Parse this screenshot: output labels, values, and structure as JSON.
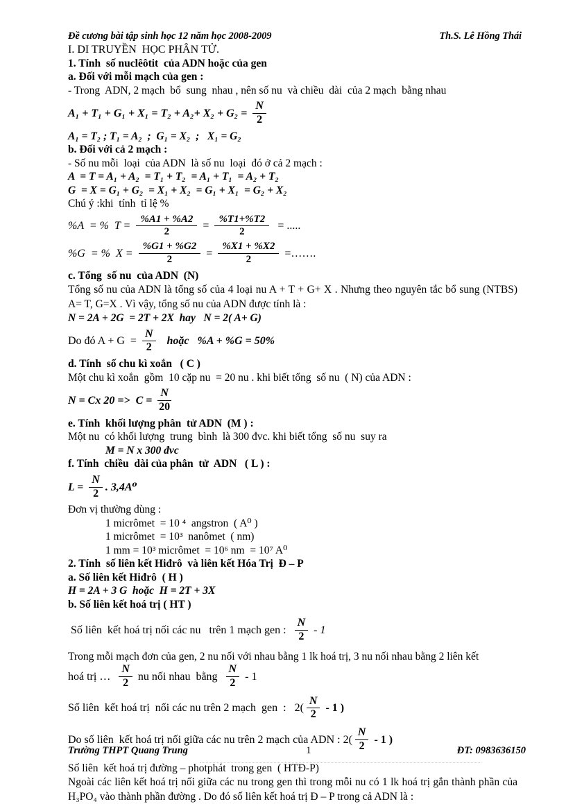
{
  "header": {
    "left": "Đề cương bài tập sinh học 12 năm học 2008-2009",
    "right": "Th.S. Lê Hồng Thái"
  },
  "sections": {
    "part1_title": "I. DI TRUYỀN  HỌC PHÂN TỬ.",
    "s1_title": "1. Tính  số nuclêôtit  của ADN hoặc của gen",
    "s1a_title": "a. Đối với mỗi mạch của gen :",
    "s1a_text": "- Trong  ADN, 2 mạch  bổ  sung  nhau , nên số nu  và chiều  dài  của 2 mạch  bằng nhau",
    "f1_left": "A₁ + T₁ + G₁ + X₁ = T₂ + A₂+ X₂ + G₂ = ",
    "f1_num": "N",
    "f1_den": "2",
    "f2": "A₁ = T₂ ; T₁ = A₂  ;  G₁ = X₂  ;   X₁ = G₂",
    "s1b_title": "b. Đối với cả 2 mạch :",
    "s1b_text": "- Số nu mỗi  loại  của ADN  là số nu  loại  đó ở cả 2 mạch :",
    "f3": "A  = T = A₁ + A₂  = T₁ + T₂  = A₁ + T₁  = A₂ + T₂",
    "f4": "G  = X = G₁ + G₂  = X₁ + X₂  = G₁ + X₁  = G₂ + X₂",
    "note_percent": "Chú ý :khi  tính  tỉ lệ %",
    "pa_label": "%A  = %  T = ",
    "pa_num1": "%A1 + %A2",
    "pa_den1": "2",
    "pa_eq": " = ",
    "pa_num2": "%T1+%T2",
    "pa_den2": "2",
    "pa_tail": "  = .....",
    "pg_label": "%G  = %  X = ",
    "pg_num1": "%G1 + %G2",
    "pg_den1": "2",
    "pg_eq": " = ",
    "pg_num2": "%X1 + %X2",
    "pg_den2": "2",
    "pg_tail": " =…….",
    "s1c_title": "c. Tổng  số nu  của ADN  (N)",
    "s1c_text": "Tổng  số nu  của ADN   là tổng  số của 4 loại  nu   A + T + G+ X . Nhưng  theo  nguyên  tắc bổ sung (NTBS) A= T, G=X . Vì vậy, tổng  số nu  của ADN  được tính  là :",
    "f5": "N = 2A + 2G  = 2T + 2X  hay   N = 2( A+ G)",
    "f6_pre": "Do đó A + G  = ",
    "f6_num": "N",
    "f6_den": "2",
    "f6_post": "   hoặc   %A + %G = 50%",
    "s1d_title": "d. Tính  số chu kì xoắn   ( C )",
    "s1d_text": "Một chu kì xoắn  gồm  10 cặp nu  = 20 nu . khi biết tổng  số nu  ( N) của ADN :",
    "f7_pre": "N = Cx 20 =>  C = ",
    "f7_num": "N",
    "f7_den": "20",
    "s1e_title": "e. Tính  khối lượng phân  tử ADN  (M ) :",
    "s1e_text": "Một nu  có khối lượng  trung  bình  là 300 đvc. khi biết tổng  số nu  suy ra",
    "f8": "M = N x 300 đvc",
    "s1f_title": "f. Tính  chiều  dài của phân  tử  ADN   ( L ) :",
    "f9_pre": "L = ",
    "f9_num": "N",
    "f9_den": "2",
    "f9_post": ". 3,4A⁰",
    "units_title": "Đơn vị thường dùng :",
    "unit1": "1 micrômet  = 10 ⁴  angstron  ( A⁰ )",
    "unit2": "1 micrômet  = 10³  nanômet  ( nm)",
    "unit3": "1 mm = 10³ micrômet  = 10⁶ nm  = 10⁷ A⁰",
    "s2_title": "2. Tính  số liên kết Hiđrô  và liên kết Hóa Trị  Đ – P",
    "s2a_title": "a. Số liên kết Hiđrô  ( H )",
    "f10": "H = 2A + 3 G  hoặc  H = 2T + 3X",
    "s2b_title": "b. Số liên kết hoá trị ( HT )",
    "f11_pre": " Số liên  kết hoá trị nối các nu   trên 1 mạch gen :  ",
    "f11_num": "N",
    "f11_den": "2",
    "f11_post": " - 1",
    "p_strand": "Trong mỗi  mạch  đơn  của gen, 2 nu  nối  với  nhau  bằng  1 lk hoá trị, 3 nu  nối nhau  bằng 2 liên  kết",
    "p_strand2_pre": "hoá trị …  ",
    "p_strand2_num": "N",
    "p_strand2_den": "2",
    "p_strand2_mid": " nu nối nhau  bằng  ",
    "p_strand2_num2": "N",
    "p_strand2_den2": "2",
    "p_strand2_post": " - 1",
    "f12_pre": "Số liên  kết hoá trị  nối các nu trên 2 mạch  gen  :   2(",
    "f12_num": "N",
    "f12_den": "2",
    "f12_post": " - 1 )",
    "f13_pre": "Do số liên  kết hoá trị nối giữa các nu trên 2 mạch của ADN : 2(",
    "f13_num": "N",
    "f13_den": "2",
    "f13_post": " - 1 )",
    "dp_title": "Số liên  kết hoá trị đường – photphát  trong gen  ( HTĐ-P)",
    "dp_text": "Ngoài các liên  kết hoá trị nối giữa  các nu trong gen thì trong mỗi  nu có 1 lk hoá trị gắn thành  phần của H₃PO₄  vào thành  phần đường . Do đó số liên  kết hoá trị Đ – P  trong cả ADN là :"
  },
  "footer": {
    "school": "Trường THPT Quang Trung",
    "page_number": "1",
    "phone": "ĐT: 0983636150"
  }
}
